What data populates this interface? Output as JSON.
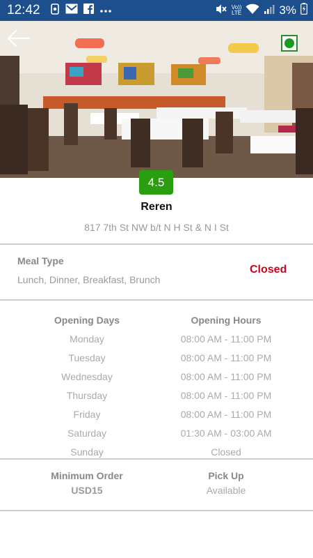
{
  "status_bar": {
    "time": "12:42",
    "network_label": "LTE",
    "volte_label": "Vo))",
    "battery": "3%",
    "left_icons": [
      "voicemail-icon",
      "gmail-icon",
      "facebook-icon",
      "more-icon"
    ],
    "right_icons": [
      "mute-icon",
      "volte-icon",
      "wifi-icon",
      "signal-icon",
      "battery-icon"
    ]
  },
  "header": {
    "back_icon": "back-arrow-icon",
    "veg_indicator": "veg-dot-icon",
    "veg_color": "#179a1f"
  },
  "restaurant": {
    "rating": "4.5",
    "rating_color": "#2a9d10",
    "name": "Reren",
    "address": "817 7th St NW b/t N H St & N I St"
  },
  "meal": {
    "title": "Meal Type",
    "value": "Lunch, Dinner, Breakfast, Brunch",
    "status": "Closed",
    "status_color": "#d0021b"
  },
  "hours": {
    "days_header": "Opening Days",
    "hours_header": "Opening Hours",
    "rows": [
      {
        "day": "Monday",
        "hours": "08:00 AM - 11:00 PM"
      },
      {
        "day": "Tuesday",
        "hours": "08:00 AM - 11:00 PM"
      },
      {
        "day": "Wednesday",
        "hours": "08:00 AM - 11:00 PM"
      },
      {
        "day": "Thursday",
        "hours": "08:00 AM - 11:00 PM"
      },
      {
        "day": "Friday",
        "hours": "08:00 AM - 11:00 PM"
      },
      {
        "day": "Saturday",
        "hours": "01:30 AM - 03:00 AM"
      },
      {
        "day": "Sunday",
        "hours": "Closed"
      }
    ]
  },
  "order": {
    "min_title": "Minimum Order",
    "min_value": "USD15",
    "pickup_title": "Pick Up",
    "pickup_value": "Available"
  }
}
